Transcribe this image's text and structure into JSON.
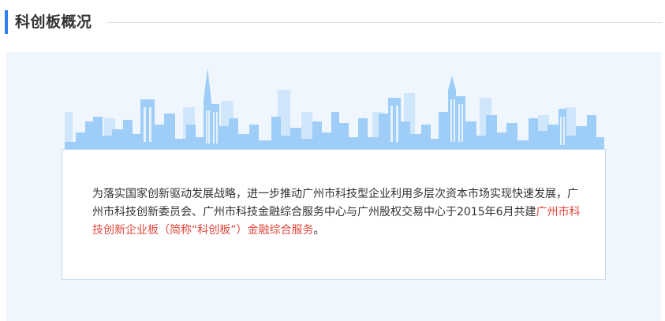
{
  "section": {
    "title": "科创板概况"
  },
  "intro": {
    "text_before": "为落实国家创新驱动发展战略，进一步推动广州市科技型企业利用多层次资本市场实现快速发展，广州市科技创新委员会、广州市科技金融综合服务中心与广州股权交易中心于2015年6月共建",
    "highlight": "广州市科技创新企业板（简称“科创板”）金融综合服务",
    "text_after": "。"
  },
  "colors": {
    "accent": "#2d7ef0",
    "highlight": "#e2473e",
    "panel_background": "#f0f6fd",
    "skyline_main": "#9ecdf8",
    "skyline_light": "#d0e6fb"
  },
  "illustration": {
    "name": "city-skyline"
  }
}
